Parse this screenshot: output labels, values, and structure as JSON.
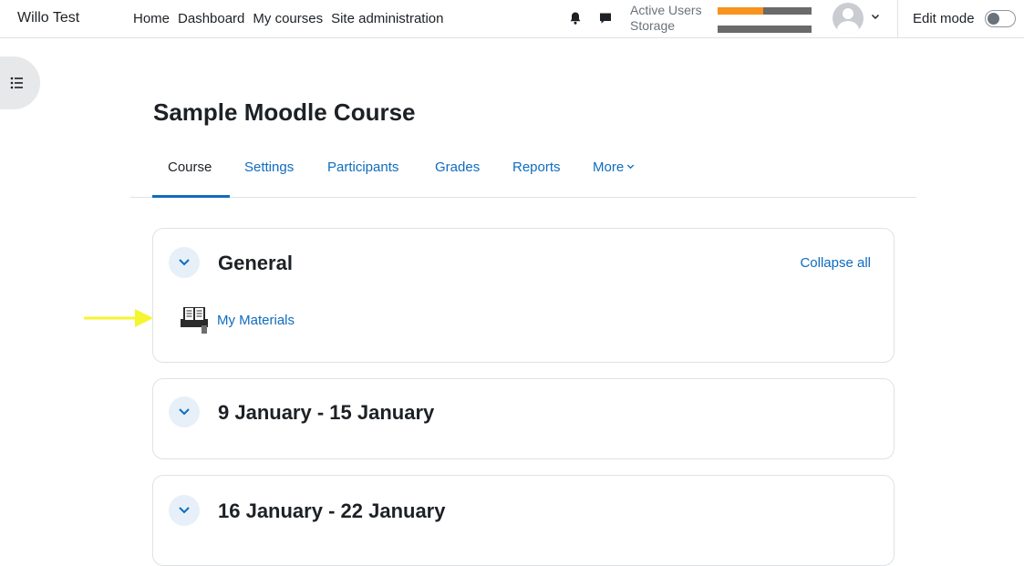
{
  "navbar": {
    "brand": "Willo Test",
    "links": [
      "Home",
      "Dashboard",
      "My courses",
      "Site administration"
    ],
    "usage": {
      "active_users_label": "Active Users",
      "active_users_fraction": 0.49,
      "storage_label": "Storage",
      "storage_fraction": 0.0,
      "fill_color": "#f7931e"
    },
    "icons": [
      "bell-icon",
      "chat-icon",
      "avatar-icon",
      "chevron-down-icon"
    ],
    "edit_mode_label": "Edit mode",
    "edit_mode_on": false
  },
  "page": {
    "title": "Sample Moodle Course",
    "tabs": [
      {
        "label": "Course",
        "active": true
      },
      {
        "label": "Settings",
        "active": false
      },
      {
        "label": "Participants",
        "active": false
      },
      {
        "label": "Grades",
        "active": false
      },
      {
        "label": "Reports",
        "active": false
      },
      {
        "label": "More",
        "active": false
      }
    ]
  },
  "sections": [
    {
      "title": "General",
      "collapse_label": "Collapse all",
      "activities": [
        {
          "label": "My Materials",
          "icon": "book-activity-icon"
        }
      ]
    },
    {
      "title": "9 January - 15 January",
      "activities": []
    },
    {
      "title": "16 January - 22 January",
      "activities": []
    }
  ],
  "colors": {
    "link": "#0f6cbf",
    "annotation_arrow": "#f5f530"
  }
}
